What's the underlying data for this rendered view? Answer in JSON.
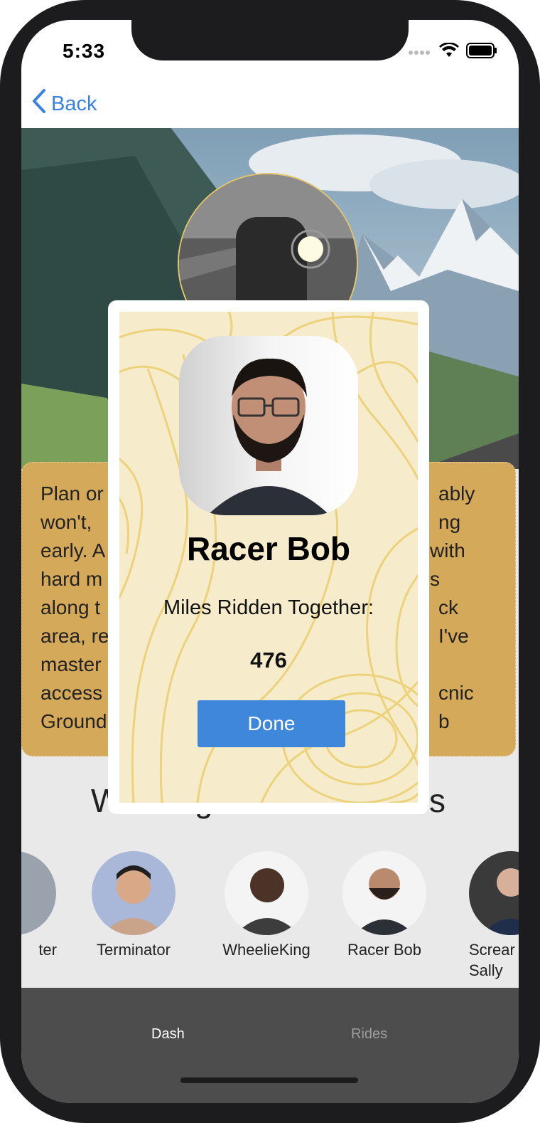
{
  "status_bar": {
    "time": "5:33",
    "wifi_icon": "wifi-icon",
    "battery_icon": "battery-icon",
    "signal_icon": "signal-icon"
  },
  "nav": {
    "back_label": "Back",
    "back_icon": "chevron-left-icon"
  },
  "story": {
    "lines_left": [
      "Plan or",
      "won't,",
      "early. A",
      "hard m",
      "along t",
      "area, re",
      "master",
      "access",
      "Ground"
    ],
    "lines_right": [
      "ably",
      "ng",
      "with",
      "s",
      "ck",
      "I've",
      "",
      "cnic",
      "b"
    ]
  },
  "section": {
    "heading_left": "W",
    "heading_mid": "g",
    "heading_right": "s"
  },
  "riders": [
    {
      "name": "ter"
    },
    {
      "name": "Terminator"
    },
    {
      "name": "WheelieKing"
    },
    {
      "name": "Racer Bob"
    },
    {
      "name": "Screar\nSally"
    }
  ],
  "tabs": {
    "dash": "Dash",
    "rides": "Rides"
  },
  "modal": {
    "name": "Racer Bob",
    "label": "Miles Ridden Together:",
    "miles": "476",
    "done_label": "Done"
  },
  "colors": {
    "accent": "#3f87db",
    "card": "#d5a95a",
    "modal_bg": "#f6eccc",
    "topo_line": "#ecd27a",
    "tabbar": "#4d4d4d"
  }
}
